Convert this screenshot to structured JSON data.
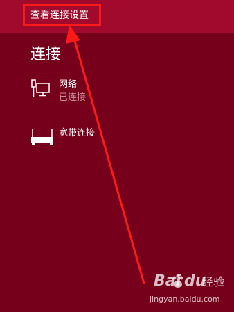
{
  "header": {
    "link_label": "查看连接设置"
  },
  "connections": {
    "title": "连接",
    "items": [
      {
        "name": "网络",
        "status": "已连接",
        "icon": "network-computer-icon"
      },
      {
        "name": "宽带连接",
        "status": "",
        "icon": "broadband-router-icon"
      }
    ]
  },
  "annotation": {
    "box_color": "#ff1a1a",
    "arrow_color": "#ff1a1a"
  },
  "watermark": {
    "brand_left": "Bai",
    "brand_right": "du",
    "product": "经验",
    "url": "jingyan.baidu.com"
  },
  "colors": {
    "background": "#76001c",
    "header": "#a10a2c",
    "status_text": "#c98a97"
  }
}
